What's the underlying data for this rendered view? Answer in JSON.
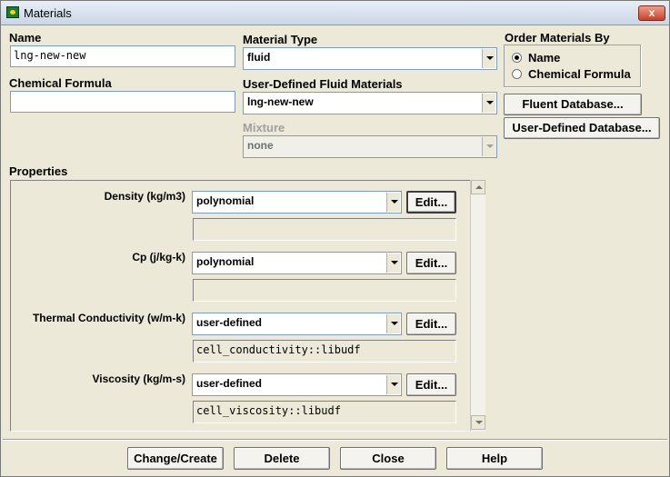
{
  "window": {
    "title": "Materials",
    "close_glyph": "x"
  },
  "name": {
    "label": "Name",
    "value": "lng-new-new"
  },
  "chemical_formula": {
    "label": "Chemical Formula",
    "value": ""
  },
  "material_type": {
    "label": "Material Type",
    "value": "fluid"
  },
  "user_defined_fluid": {
    "label": "User-Defined Fluid Materials",
    "value": "lng-new-new"
  },
  "mixture": {
    "label": "Mixture",
    "value": "none"
  },
  "order_by": {
    "label": "Order Materials By",
    "options": [
      {
        "label": "Name",
        "checked": true
      },
      {
        "label": "Chemical Formula",
        "checked": false
      }
    ]
  },
  "database_buttons": {
    "fluent": "Fluent Database...",
    "user_defined": "User-Defined Database..."
  },
  "properties": {
    "label": "Properties",
    "items": [
      {
        "label": "Density (kg/m3)",
        "method": "polynomial",
        "edit": "Edit...",
        "detail": ""
      },
      {
        "label": "Cp (j/kg-k)",
        "method": "polynomial",
        "edit": "Edit...",
        "detail": ""
      },
      {
        "label": "Thermal Conductivity (w/m-k)",
        "method": "user-defined",
        "edit": "Edit...",
        "detail": "cell_conductivity::libudf"
      },
      {
        "label": "Viscosity (kg/m-s)",
        "method": "user-defined",
        "edit": "Edit...",
        "detail": "cell_viscosity::libudf"
      }
    ]
  },
  "footer_buttons": {
    "change_create": "Change/Create",
    "delete": "Delete",
    "close": "Close",
    "help": "Help"
  }
}
